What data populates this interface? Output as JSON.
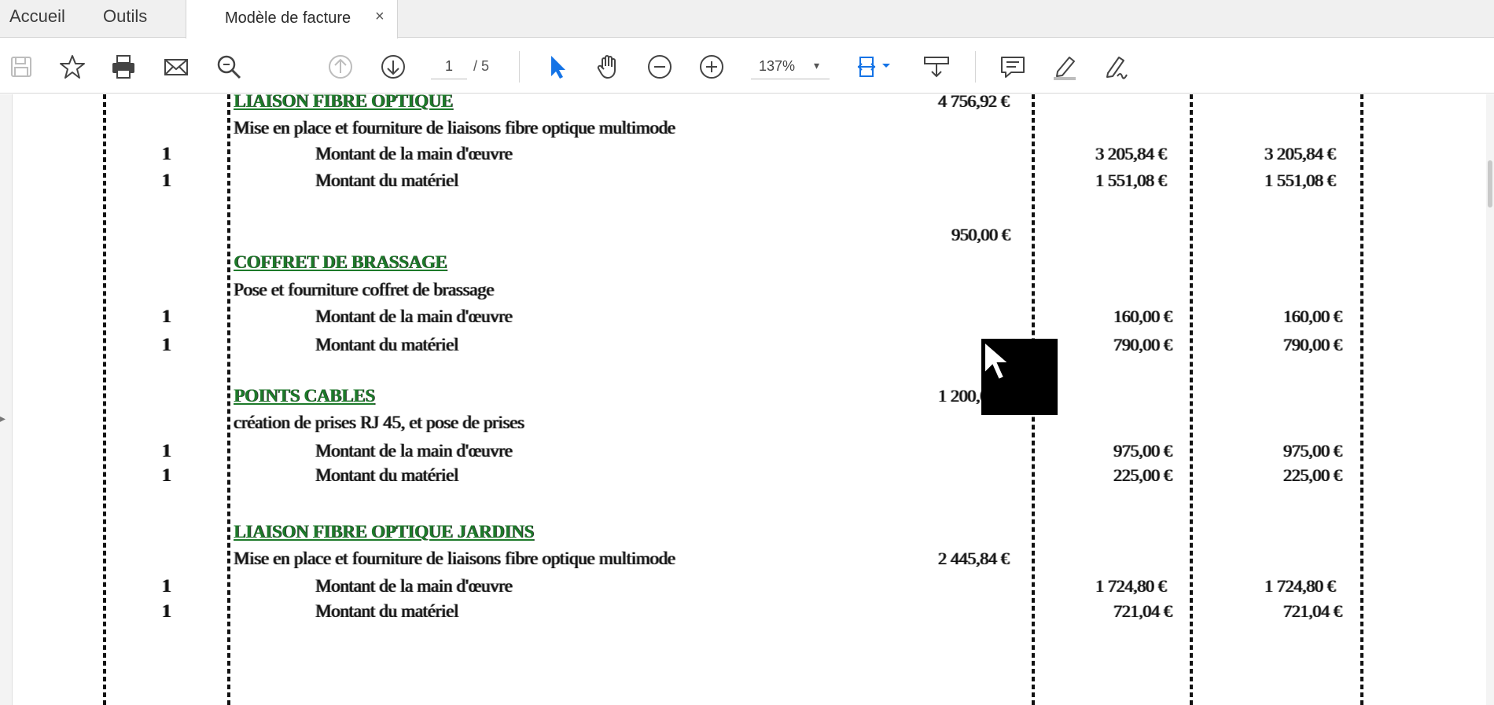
{
  "tabs": {
    "home": "Accueil",
    "tools": "Outils",
    "document": "Modèle de facture",
    "close": "×"
  },
  "toolbar": {
    "current_page": "1",
    "total_pages": "/ 5",
    "zoom": "137%",
    "zoom_arrow": "▾",
    "accent_color": "#1473e6",
    "icons": [
      "save-icon",
      "bookmark-star-icon",
      "print-icon",
      "email-icon",
      "search-icon",
      "page-up-icon",
      "page-down-icon",
      "select-pointer-icon",
      "hand-tool-icon",
      "zoom-out-icon",
      "zoom-in-icon",
      "fit-page-icon",
      "scroll-mode-icon",
      "comment-icon",
      "highlight-icon",
      "sign-icon"
    ]
  },
  "document": {
    "rows": [
      {
        "id": "h1",
        "text": "LIAISON FIBRE OPTIQUE",
        "amount": "4 756,92 €"
      },
      {
        "id": "d1",
        "text": "Mise en place et fourniture de liaisons fibre optique multimode"
      },
      {
        "id": "r1a",
        "qty": "1",
        "text": "Montant de la main d'œuvre",
        "unit": "3 205,84 €",
        "total": "3 205,84 €"
      },
      {
        "id": "r1b",
        "qty": "1",
        "text": "Montant du matériel",
        "unit": "1 551,08 €",
        "total": "1 551,08 €"
      },
      {
        "id": "a2",
        "amount": "950,00 €"
      },
      {
        "id": "h2",
        "text": "COFFRET DE BRASSAGE"
      },
      {
        "id": "d2",
        "text": "Pose et fourniture coffret de brassage"
      },
      {
        "id": "r2a",
        "qty": "1",
        "text": "Montant de la main d'œuvre",
        "unit": "160,00 €",
        "total": "160,00 €"
      },
      {
        "id": "r2b",
        "qty": "1",
        "text": "Montant du matériel",
        "unit": "790,00 €",
        "total": "790,00 €"
      },
      {
        "id": "h3",
        "text": "POINTS CABLES",
        "amount": "1 200,00 €"
      },
      {
        "id": "d3",
        "text": "création de prises RJ 45, et pose de prises"
      },
      {
        "id": "r3a",
        "qty": "1",
        "text": "Montant de la main d'œuvre",
        "unit": "975,00 €",
        "total": "975,00 €"
      },
      {
        "id": "r3b",
        "qty": "1",
        "text": "Montant du matériel",
        "unit": "225,00 €",
        "total": "225,00 €"
      },
      {
        "id": "h4",
        "text": "LIAISON FIBRE OPTIQUE JARDINS"
      },
      {
        "id": "d4",
        "text": "Mise en place et fourniture de liaisons fibre optique multimode",
        "amount": "2 445,84 €"
      },
      {
        "id": "r4a",
        "qty": "1",
        "text": "Montant de la main d'œuvre",
        "unit": "1 724,80 €",
        "total": "1 724,80 €"
      },
      {
        "id": "r4b",
        "qty": "1",
        "text": "Montant du matériel",
        "unit": "721,04 €",
        "total": "721,04 €"
      }
    ]
  }
}
